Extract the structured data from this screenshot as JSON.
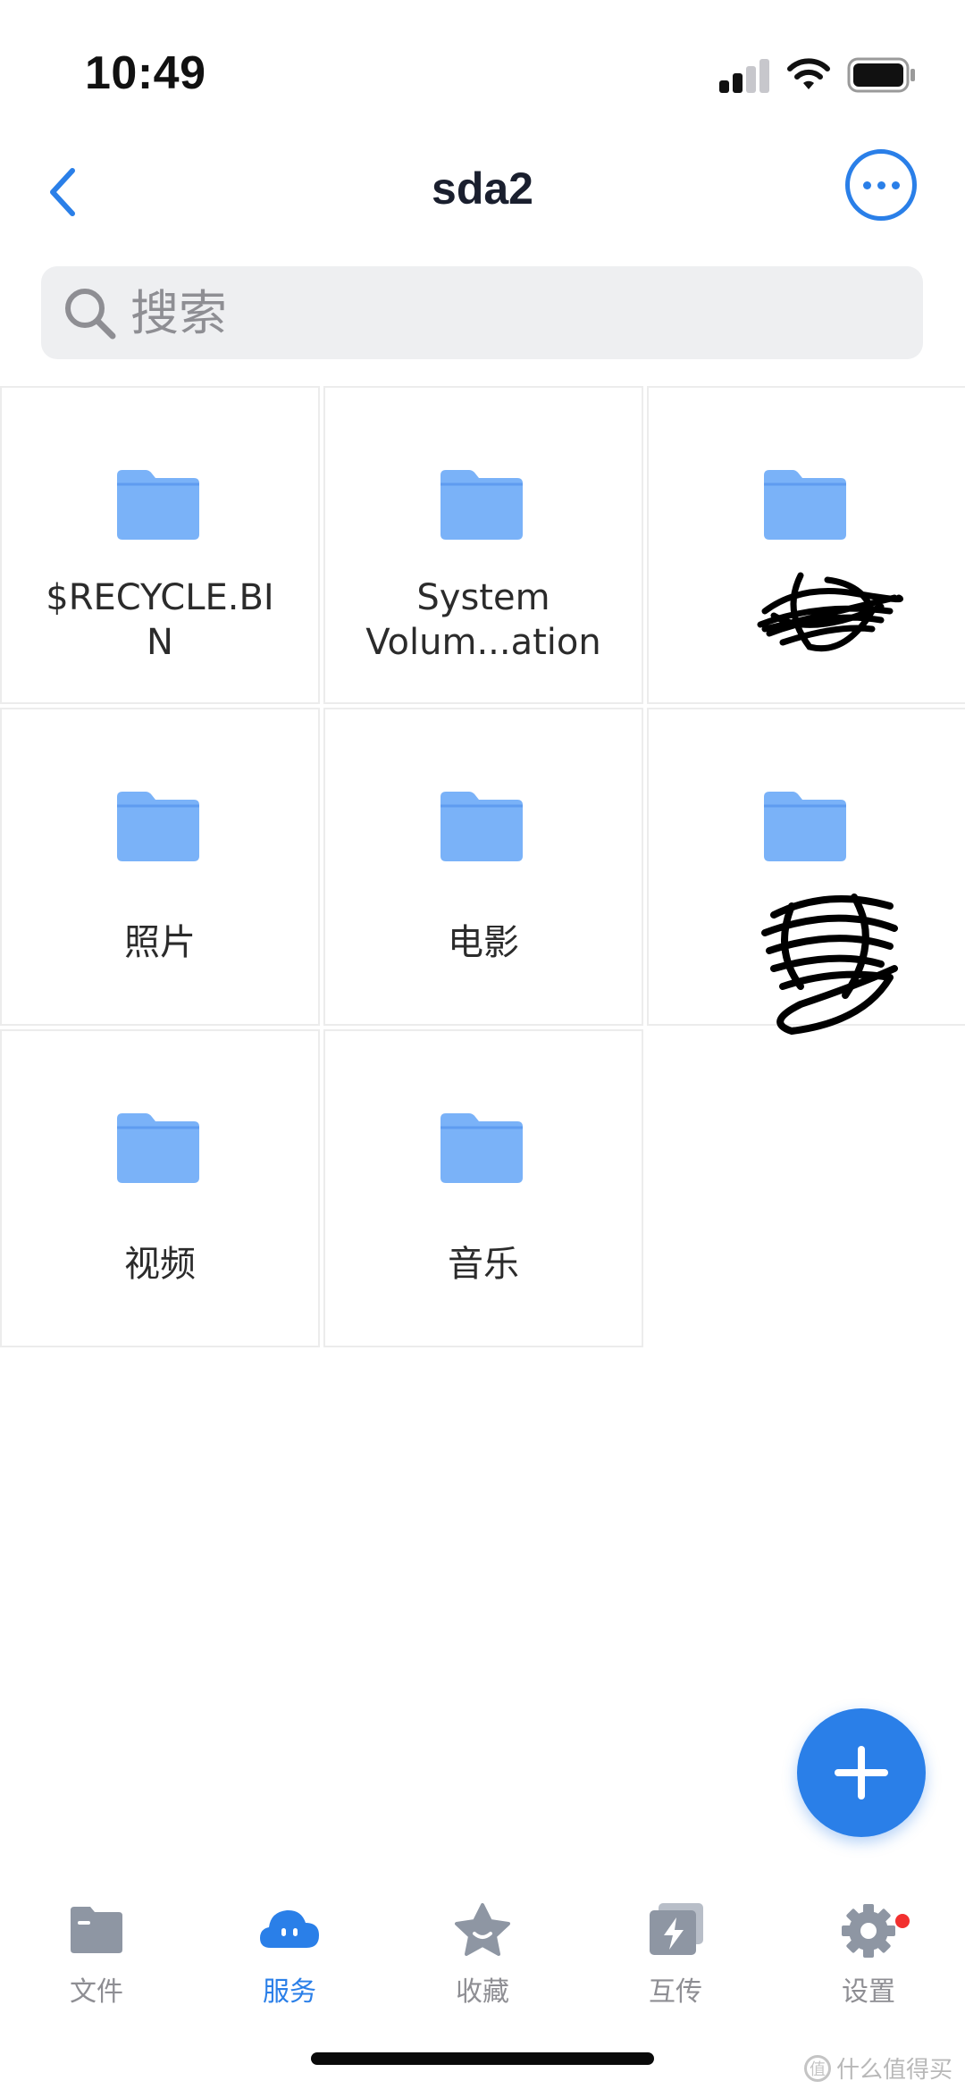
{
  "status_bar": {
    "time": "10:49"
  },
  "nav": {
    "title": "sda2",
    "back_icon": "chevron-left-icon",
    "more_icon": "ellipsis-circle-icon"
  },
  "search": {
    "placeholder": "搜索"
  },
  "folders": [
    {
      "label": "$RECYCLE.BI\nN",
      "line1": "$RECYCLE.BI",
      "line2": "N",
      "redacted": false
    },
    {
      "label": "System Volum...ation",
      "line1": "System",
      "line2": "Volum...ation",
      "redacted": false
    },
    {
      "label": "",
      "line1": "",
      "line2": "",
      "redacted": true
    },
    {
      "label": "照片",
      "line1": "照片",
      "line2": "",
      "redacted": false
    },
    {
      "label": "电影",
      "line1": "电影",
      "line2": "",
      "redacted": false
    },
    {
      "label": "",
      "line1": "",
      "line2": "",
      "redacted": true
    },
    {
      "label": "视频",
      "line1": "视频",
      "line2": "",
      "redacted": false
    },
    {
      "label": "音乐",
      "line1": "音乐",
      "line2": "",
      "redacted": false
    }
  ],
  "fab": {
    "icon": "plus-icon"
  },
  "tabs": [
    {
      "label": "文件",
      "icon": "folder-icon",
      "active": false
    },
    {
      "label": "服务",
      "icon": "cloud-icon",
      "active": true
    },
    {
      "label": "收藏",
      "icon": "star-icon",
      "active": false
    },
    {
      "label": "互传",
      "icon": "transfer-icon",
      "active": false
    },
    {
      "label": "设置",
      "icon": "gear-icon",
      "active": false,
      "badge": true
    }
  ],
  "watermark": {
    "text": "什么值得买"
  },
  "colors": {
    "accent": "#2a7fe8",
    "folder": "#7ab2f8",
    "tab_inactive": "#8e8e93",
    "badge": "#f2302f"
  }
}
